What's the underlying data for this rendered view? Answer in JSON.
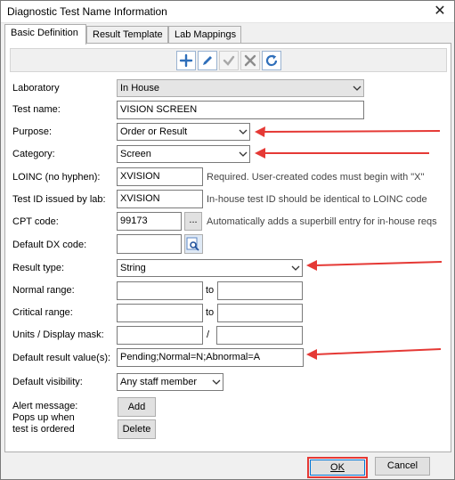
{
  "window": {
    "title": "Diagnostic Test Name Information",
    "close_glyph": "✕"
  },
  "tabs": [
    {
      "label": "Basic Definition"
    },
    {
      "label": "Result Template"
    },
    {
      "label": "Lab Mappings"
    }
  ],
  "toolbar": {
    "add_icon": "plus-icon",
    "edit_icon": "pencil-icon",
    "save_icon": "check-icon",
    "cancel_icon": "x-icon",
    "refresh_icon": "refresh-icon"
  },
  "form": {
    "laboratory": {
      "label": "Laboratory",
      "value": "In House"
    },
    "test_name": {
      "label": "Test name:",
      "value": "VISION SCREEN"
    },
    "purpose": {
      "label": "Purpose:",
      "value": "Order or Result"
    },
    "category": {
      "label": "Category:",
      "value": "Screen"
    },
    "loinc": {
      "label": "LOINC (no hyphen):",
      "value": "XVISION",
      "hint": "Required. User-created codes must begin with \"X\""
    },
    "test_id": {
      "label": "Test ID issued by lab:",
      "value": "XVISION",
      "hint": "In-house test ID should be identical to LOINC code"
    },
    "cpt": {
      "label": "CPT code:",
      "value": "99173",
      "browse": "...",
      "hint": "Automatically adds a superbill entry for in-house reqs"
    },
    "default_dx": {
      "label": "Default DX code:",
      "value": ""
    },
    "result_type": {
      "label": "Result type:",
      "value": "String"
    },
    "normal_range": {
      "label": "Normal range:",
      "from": "",
      "to_label": "to",
      "to": ""
    },
    "critical_range": {
      "label": "Critical range:",
      "from": "",
      "to_label": "to",
      "to": ""
    },
    "units": {
      "label": "Units / Display mask:",
      "units": "",
      "sep": "/",
      "mask": ""
    },
    "default_result": {
      "label": "Default result value(s):",
      "value": "Pending;Normal=N;Abnormal=A"
    },
    "default_visibility": {
      "label": "Default visibility:",
      "value": "Any staff member"
    },
    "alert": {
      "label_line1": "Alert message:",
      "label_line2": "Pops up when",
      "label_line3": "test is ordered",
      "add_label": "Add",
      "delete_label": "Delete"
    }
  },
  "footer": {
    "ok_label": "OK",
    "cancel_label": "Cancel"
  },
  "colors": {
    "annotation_arrow": "#e53935",
    "focus_border": "#0078d7"
  }
}
